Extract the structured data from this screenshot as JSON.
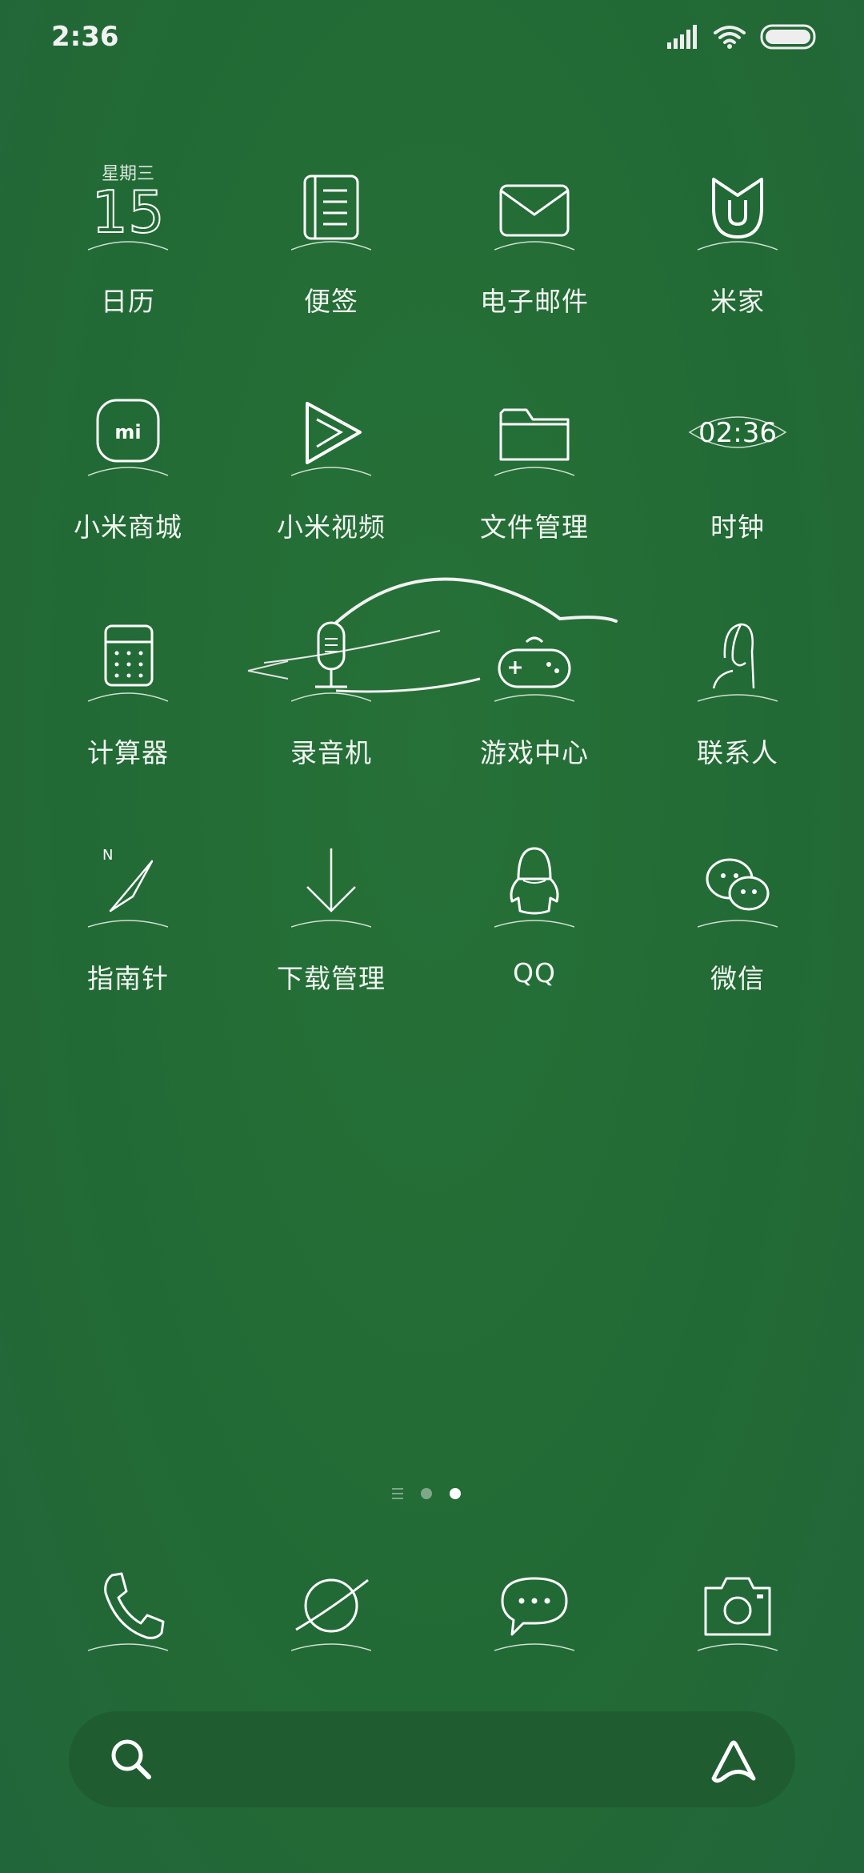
{
  "status": {
    "time": "2:36"
  },
  "calendar": {
    "weekday": "星期三",
    "day": "15"
  },
  "clock_widget": {
    "time": "02:36"
  },
  "compass_widget": {
    "north": "N"
  },
  "apps": [
    [
      {
        "label": "日历"
      },
      {
        "label": "便签"
      },
      {
        "label": "电子邮件"
      },
      {
        "label": "米家"
      }
    ],
    [
      {
        "label": "小米商城"
      },
      {
        "label": "小米视频"
      },
      {
        "label": "文件管理"
      },
      {
        "label": "时钟"
      }
    ],
    [
      {
        "label": "计算器"
      },
      {
        "label": "录音机"
      },
      {
        "label": "游戏中心"
      },
      {
        "label": "联系人"
      }
    ],
    [
      {
        "label": "指南针"
      },
      {
        "label": "下载管理"
      },
      {
        "label": "QQ"
      },
      {
        "label": "微信"
      }
    ]
  ],
  "mi_store_logo": "mi",
  "page_indicator": {
    "pages": 3,
    "current_page": 3
  },
  "dock": [
    {
      "icon": "phone-icon"
    },
    {
      "icon": "browser-icon"
    },
    {
      "icon": "messages-icon"
    },
    {
      "icon": "camera-icon"
    }
  ],
  "colors": {
    "background": "#246c38",
    "search_bar": "#1f5d31"
  }
}
